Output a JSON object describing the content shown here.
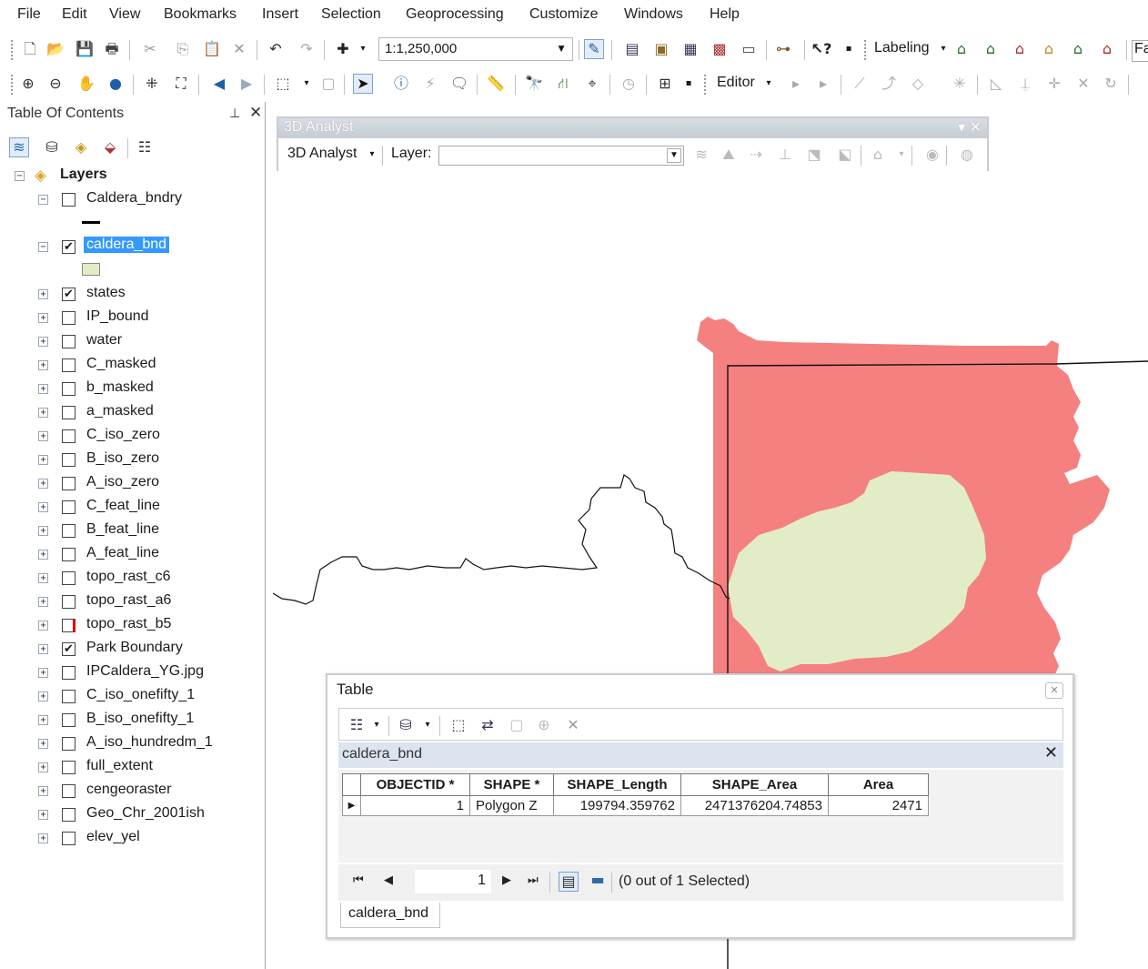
{
  "menu": [
    "File",
    "Edit",
    "View",
    "Bookmarks",
    "Insert",
    "Selection",
    "Geoprocessing",
    "Customize",
    "Windows",
    "Help"
  ],
  "toolbar1": {
    "scale": "1:1,250,000",
    "labeling": "Labeling",
    "overflow_text": "Fa",
    "icons": [
      "new-icon",
      "open-icon",
      "save-icon",
      "print-icon",
      "cut-icon",
      "copy-icon",
      "paste-icon",
      "delete-icon",
      "undo-icon",
      "redo-icon",
      "add-data-icon",
      "editor-toolbar-icon",
      "toc-icon",
      "catalog-icon",
      "search-icon",
      "arctoolbox-icon",
      "python-icon",
      "modelbuilder-icon",
      "whats-this-icon"
    ]
  },
  "toolbar2": {
    "editor": "Editor",
    "icons": [
      "zoom-in-icon",
      "zoom-out-icon",
      "pan-icon",
      "full-extent-icon",
      "fixed-zoom-in-icon",
      "fixed-zoom-out-icon",
      "back-icon",
      "forward-icon",
      "select-features-icon",
      "clear-selection-icon",
      "select-elements-icon",
      "identify-icon",
      "hyperlink-icon",
      "html-popup-icon",
      "measure-icon",
      "find-icon",
      "find-route-icon",
      "go-to-xy-icon",
      "time-slider-icon",
      "create-viewer-icon"
    ]
  },
  "toc": {
    "title": "Table Of Contents",
    "root": "Layers",
    "layers": [
      {
        "name": "Caldera_bndry",
        "checked": false,
        "expanded": true,
        "symbol": "line"
      },
      {
        "name": "caldera_bnd",
        "checked": true,
        "expanded": true,
        "selected": true,
        "symbol": "polygon"
      },
      {
        "name": "states",
        "checked": true
      },
      {
        "name": "IP_bound",
        "checked": false
      },
      {
        "name": "water",
        "checked": false
      },
      {
        "name": "C_masked",
        "checked": false
      },
      {
        "name": "b_masked",
        "checked": false
      },
      {
        "name": "a_masked",
        "checked": false
      },
      {
        "name": "C_iso_zero",
        "checked": false
      },
      {
        "name": "B_iso_zero",
        "checked": false
      },
      {
        "name": "A_iso_zero",
        "checked": false
      },
      {
        "name": "C_feat_line",
        "checked": false
      },
      {
        "name": "B_feat_line",
        "checked": false
      },
      {
        "name": "A_feat_line",
        "checked": false
      },
      {
        "name": "topo_rast_c6",
        "checked": false
      },
      {
        "name": "topo_rast_a6",
        "checked": false
      },
      {
        "name": "topo_rast_b5",
        "checked": false,
        "warning": true
      },
      {
        "name": "Park Boundary",
        "checked": true
      },
      {
        "name": "IPCaldera_YG.jpg",
        "checked": false
      },
      {
        "name": "C_iso_onefifty_1",
        "checked": false
      },
      {
        "name": "B_iso_onefifty_1",
        "checked": false
      },
      {
        "name": "A_iso_hundredm_1",
        "checked": false
      },
      {
        "name": "full_extent",
        "checked": false
      },
      {
        "name": "cengeoraster",
        "checked": false
      },
      {
        "name": "Geo_Chr_2001ish",
        "checked": false
      },
      {
        "name": "elev_yel",
        "checked": false
      }
    ]
  },
  "analyst": {
    "title": "3D Analyst",
    "menu": "3D Analyst",
    "layer_label": "Layer:",
    "layer_value": ""
  },
  "table": {
    "title": "Table",
    "tab_name": "caldera_bnd",
    "columns": [
      "OBJECTID *",
      "SHAPE *",
      "SHAPE_Length",
      "SHAPE_Area",
      "Area"
    ],
    "rows": [
      [
        "1",
        "Polygon Z",
        "199794.359762",
        "2471376204.74853",
        "2471"
      ]
    ],
    "current_record": "1",
    "selected_status": "(0 out of 1 Selected)",
    "bottom_tab": "caldera_bnd"
  },
  "colors": {
    "state_fill": "#f58080",
    "caldera_fill": "#e2edc8",
    "selection": "#3399ff"
  }
}
